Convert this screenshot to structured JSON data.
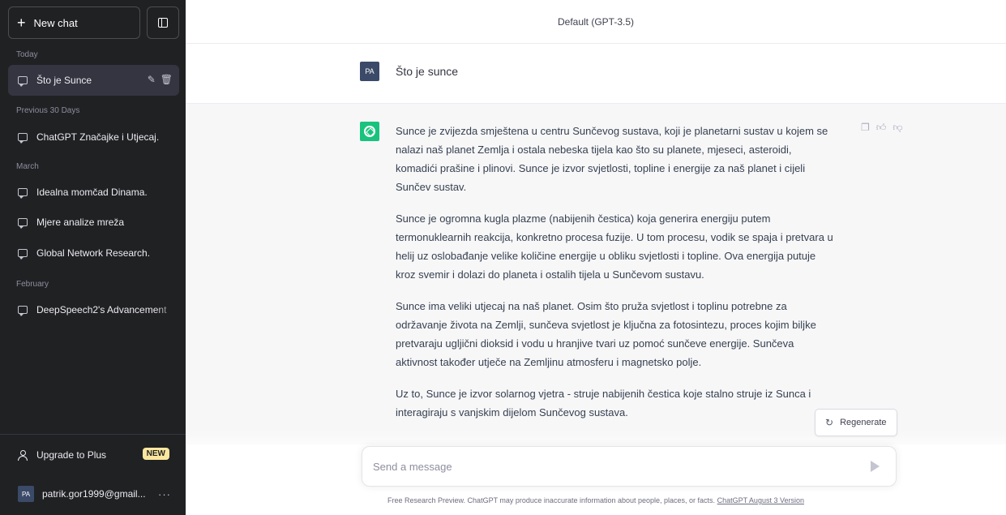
{
  "sidebar": {
    "new_chat_label": "New chat",
    "sections": [
      {
        "label": "Today"
      },
      {
        "label": "Previous 30 Days"
      },
      {
        "label": "March"
      },
      {
        "label": "February"
      }
    ],
    "chats": [
      {
        "title": "Što je Sunce",
        "active": true
      },
      {
        "title": "ChatGPT Značajke i Utjecaj."
      },
      {
        "title": "Idealna momčad Dinama."
      },
      {
        "title": "Mjere analize mreža"
      },
      {
        "title": "Global Network Research."
      },
      {
        "title": "DeepSpeech2's Advancement"
      }
    ],
    "upgrade_label": "Upgrade to Plus",
    "new_badge": "NEW",
    "account_initials": "PA",
    "account_email": "patrik.gor1999@gmail...",
    "account_more": "···"
  },
  "header": {
    "model": "Default (GPT-3.5)"
  },
  "conversation": {
    "user_initials": "PA",
    "user_message": "Što je sunce",
    "assistant_paragraphs": [
      "Sunce je zvijezda smještena u centru Sunčevog sustava, koji je planetarni sustav u kojem se nalazi naš planet Zemlja i ostala nebeska tijela kao što su planete, mjeseci, asteroidi, komadići prašine i plinovi. Sunce je izvor svjetlosti, topline i energije za naš planet i cijeli Sunčev sustav.",
      "Sunce je ogromna kugla plazme (nabijenih čestica) koja generira energiju putem termonuklearnih reakcija, konkretno procesa fuzije. U tom procesu, vodik se spaja i pretvara u helij uz oslobađanje velike količine energije u obliku svjetlosti i topline. Ova energija putuje kroz svemir i dolazi do planeta i ostalih tijela u Sunčevom sustavu.",
      "Sunce ima veliki utjecaj na naš planet. Osim što pruža svjetlost i toplinu potrebne za održavanje života na Zemlji, sunčeva svjetlost je ključna za fotosintezu, proces kojim biljke pretvaraju ugljični dioksid i vodu u hranjive tvari uz pomoć sunčeve energije. Sunčeva aktivnost također utječe na Zemljinu atmosferu i magnetsko polje.",
      "Uz to, Sunce je izvor solarnog vjetra - struje nabijenih čestica koje stalno struje iz Sunca i interagiraju s vanjskim dijelom Sunčevog sustava."
    ]
  },
  "regenerate_label": "Regenerate",
  "input": {
    "placeholder": "Send a message"
  },
  "footer": {
    "text": "Free Research Preview. ChatGPT may produce inaccurate information about people, places, or facts.",
    "link": "ChatGPT August 3 Version"
  },
  "colors": {
    "sidebar_bg": "#202123",
    "assistant_bg": "#f7f7f8",
    "gpt_green": "#19c37d",
    "badge": "#fae69e"
  }
}
